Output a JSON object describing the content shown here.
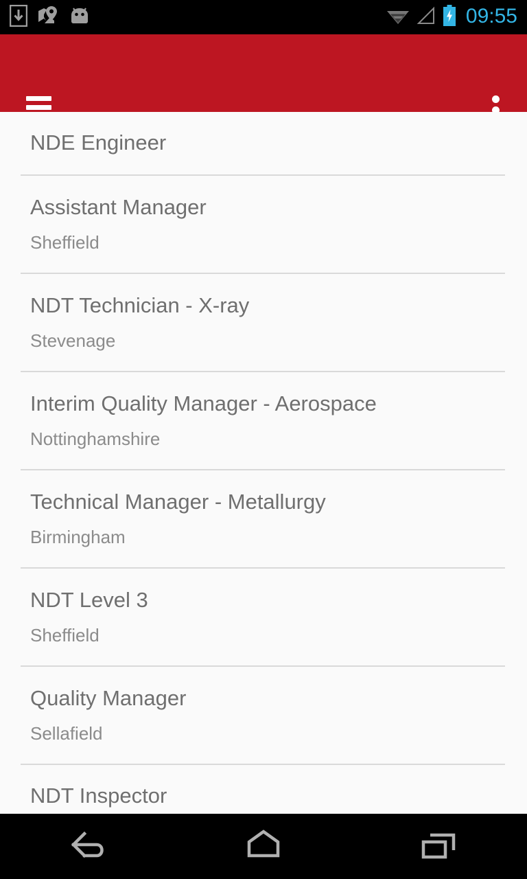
{
  "status_bar": {
    "icons_left": [
      "download-icon",
      "maps-icon",
      "android-robot-icon"
    ],
    "icons_right": [
      "wifi-icon",
      "cell-signal-icon",
      "battery-charging-icon"
    ],
    "clock": "09:55",
    "clock_color": "#33b5e5",
    "background": "#000000"
  },
  "app_bar": {
    "background": "#bd1622",
    "menu_icon": "hamburger-menu-icon",
    "overflow_icon": "overflow-menu-icon",
    "title": ""
  },
  "job_list": {
    "background": "#fafafa",
    "title_color": "#6f6f6f",
    "location_color": "#8b8b8b",
    "divider_color": "#d9d9d9",
    "items": [
      {
        "title": "NDE Engineer",
        "location": ""
      },
      {
        "title": "Assistant Manager",
        "location": "Sheffield"
      },
      {
        "title": "NDT Technician - X-ray",
        "location": "Stevenage"
      },
      {
        "title": "Interim Quality Manager - Aerospace",
        "location": "Nottinghamshire"
      },
      {
        "title": "Technical Manager - Metallurgy",
        "location": "Birmingham"
      },
      {
        "title": "NDT Level 3",
        "location": "Sheffield"
      },
      {
        "title": "Quality Manager",
        "location": "Sellafield"
      },
      {
        "title": "NDT Inspector",
        "location": ""
      }
    ]
  },
  "nav_bar": {
    "background": "#000000",
    "buttons": [
      {
        "name": "back-button",
        "icon": "back-arrow-icon"
      },
      {
        "name": "home-button",
        "icon": "home-icon"
      },
      {
        "name": "recents-button",
        "icon": "recent-apps-icon"
      }
    ]
  }
}
